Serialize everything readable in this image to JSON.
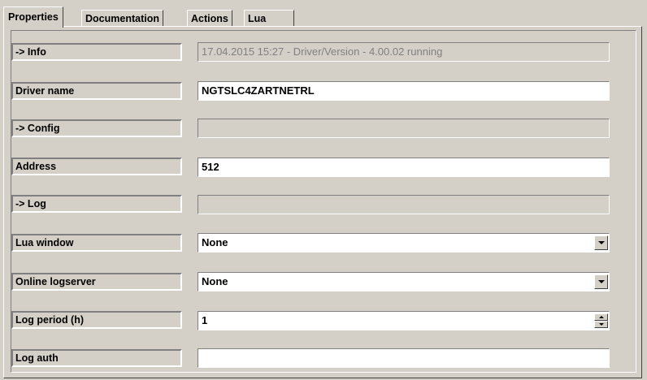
{
  "tabs": [
    {
      "label": "Properties",
      "active": true
    },
    {
      "label": "Documentation",
      "active": false
    },
    {
      "label": "Actions",
      "active": false
    },
    {
      "label": "Lua",
      "active": false
    }
  ],
  "rows": {
    "info": {
      "label": "-> Info",
      "value": "17.04.2015 15:27 - Driver/Version - 4.00.02 running"
    },
    "driver_name": {
      "label": "Driver name",
      "value": "NGTSLC4ZARTNETRL"
    },
    "config": {
      "label": "-> Config",
      "value": ""
    },
    "address": {
      "label": "Address",
      "value": "512"
    },
    "log": {
      "label": "-> Log",
      "value": ""
    },
    "lua_window": {
      "label": "Lua window",
      "value": "None"
    },
    "online_logserver": {
      "label": "Online logserver",
      "value": "None"
    },
    "log_period": {
      "label": "Log period (h)",
      "value": "1"
    },
    "log_auth": {
      "label": "Log auth",
      "value": ""
    }
  },
  "icons": {
    "dropdown": "chevron-down-icon",
    "spinner": "spinner-icon"
  }
}
